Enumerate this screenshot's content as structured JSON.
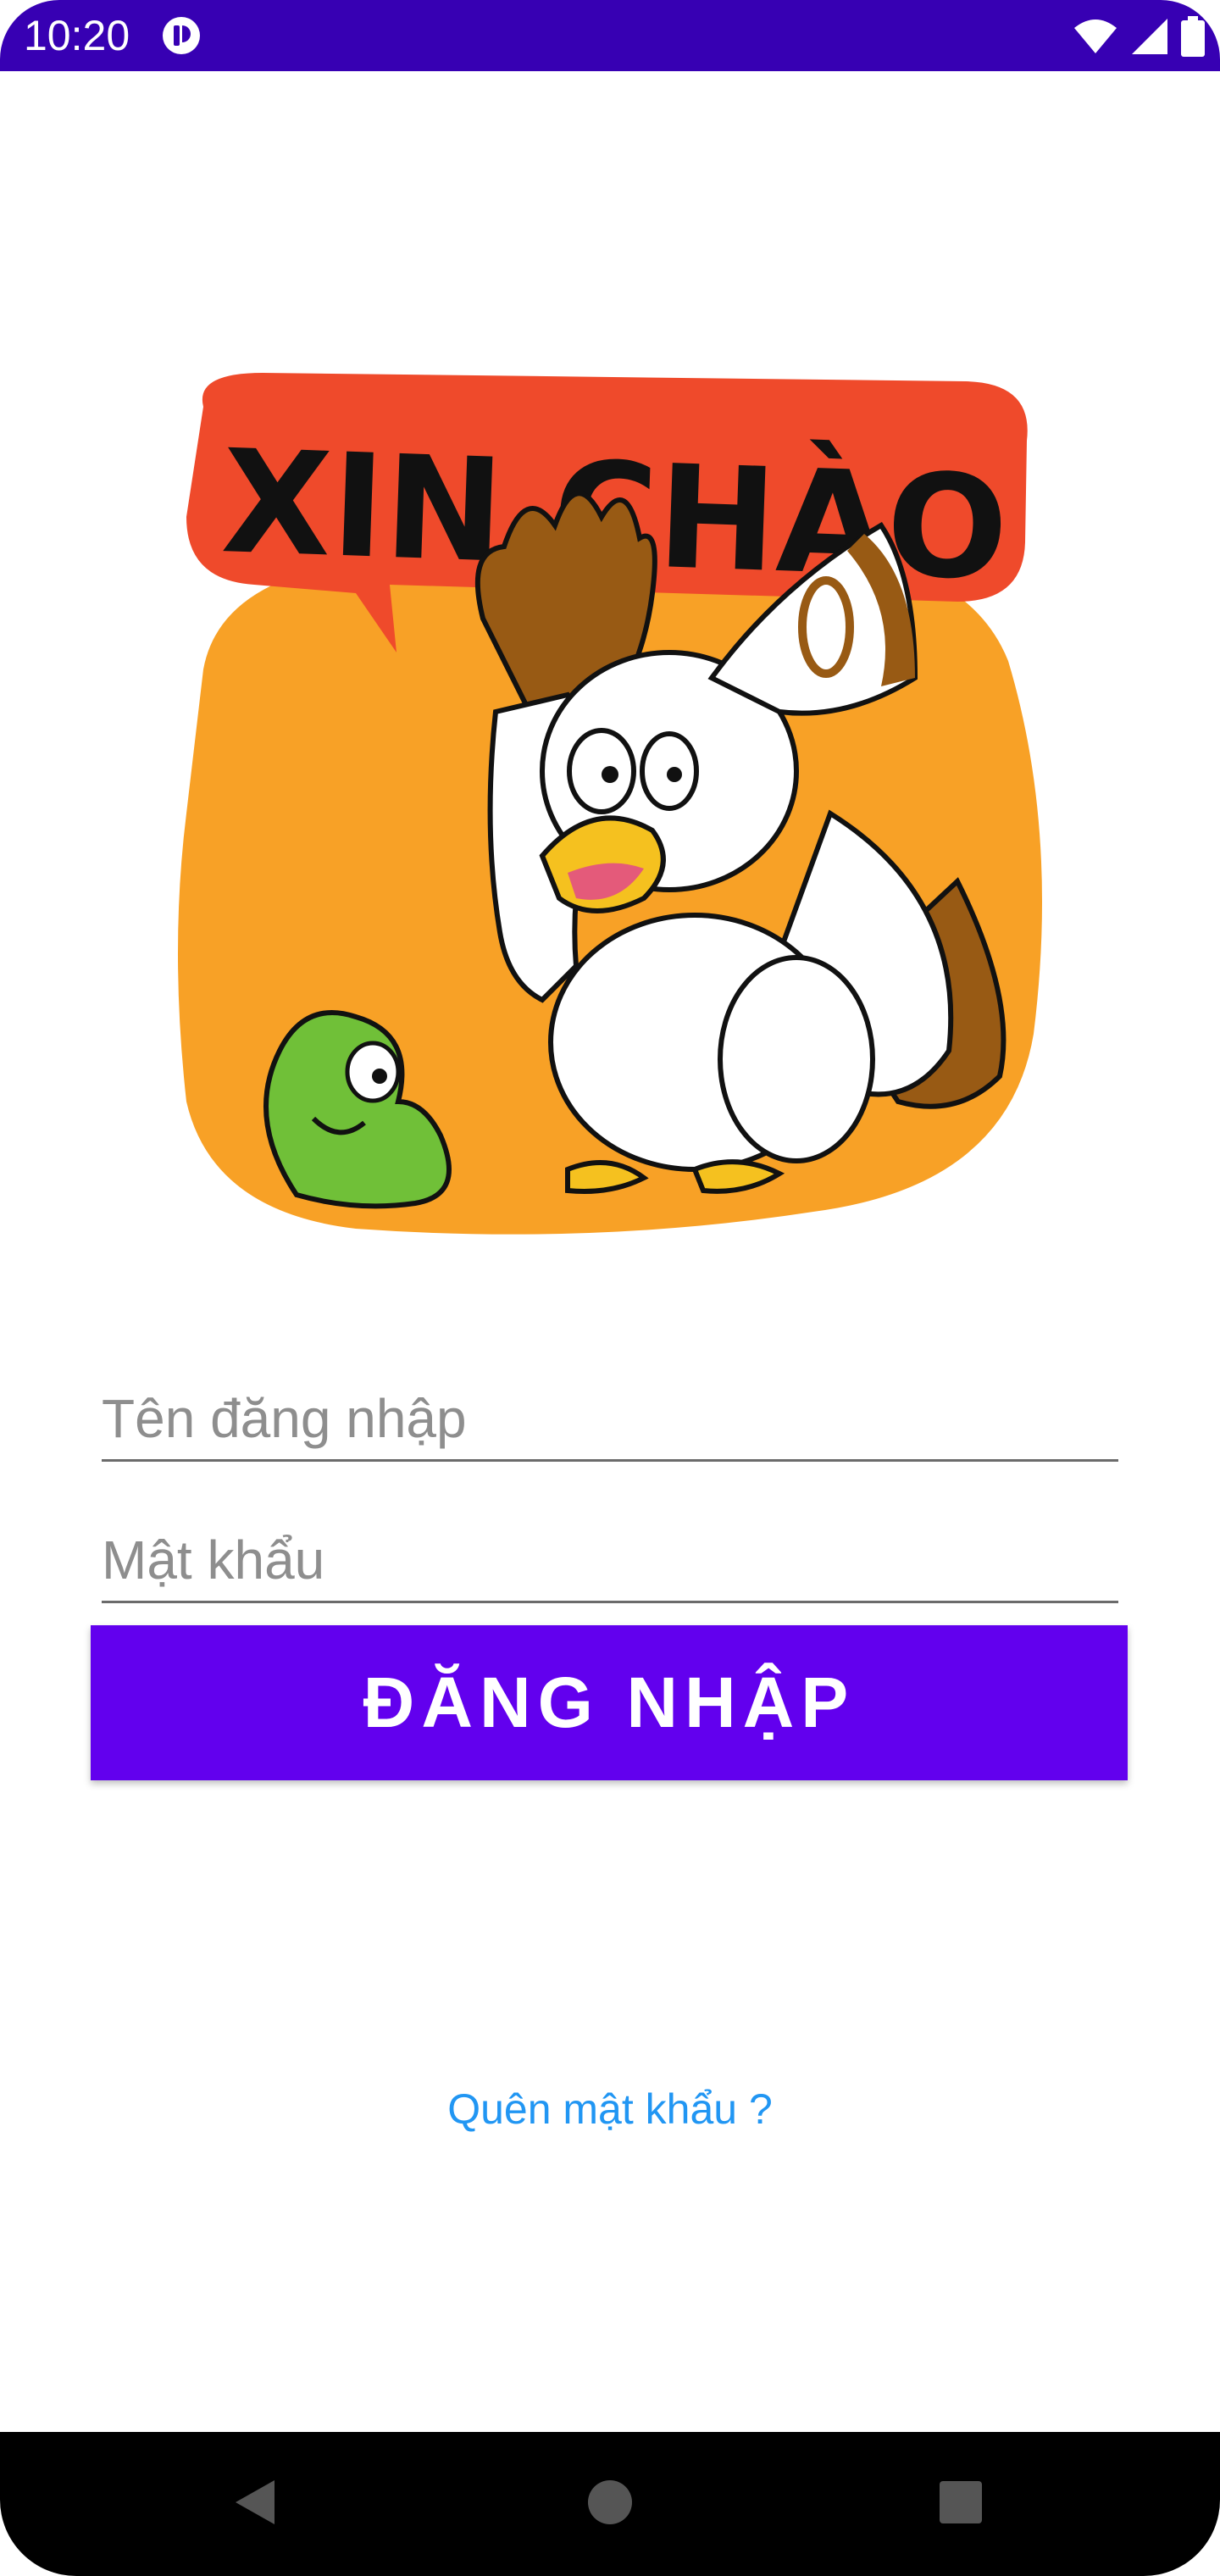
{
  "status_bar": {
    "time": "10:20",
    "icons": [
      "app-notification-icon",
      "wifi-icon",
      "signal-icon",
      "battery-icon"
    ]
  },
  "hero": {
    "speech_bubble_text": "XIN CHÀO",
    "colors": {
      "bubble": "#ef4a2b",
      "blob": "#f8a126",
      "chicken_body": "#ffffff",
      "chicken_brown": "#985a14",
      "beak": "#f5c11f",
      "worm": "#70c038"
    }
  },
  "form": {
    "username_placeholder": "Tên đăng nhập",
    "username_value": "",
    "password_placeholder": "Mật khẩu",
    "password_value": "",
    "login_label": "ĐĂNG NHẬP",
    "forgot_password_label": "Quên mật khẩu ?"
  },
  "nav_bar": {
    "buttons": [
      "back-icon",
      "home-icon",
      "recents-icon"
    ]
  },
  "colors": {
    "status_bar": "#3700b3",
    "primary_button": "#6200ee",
    "link": "#2196f3",
    "field_underline": "#6b6b6b",
    "placeholder": "#8e8e8e"
  }
}
